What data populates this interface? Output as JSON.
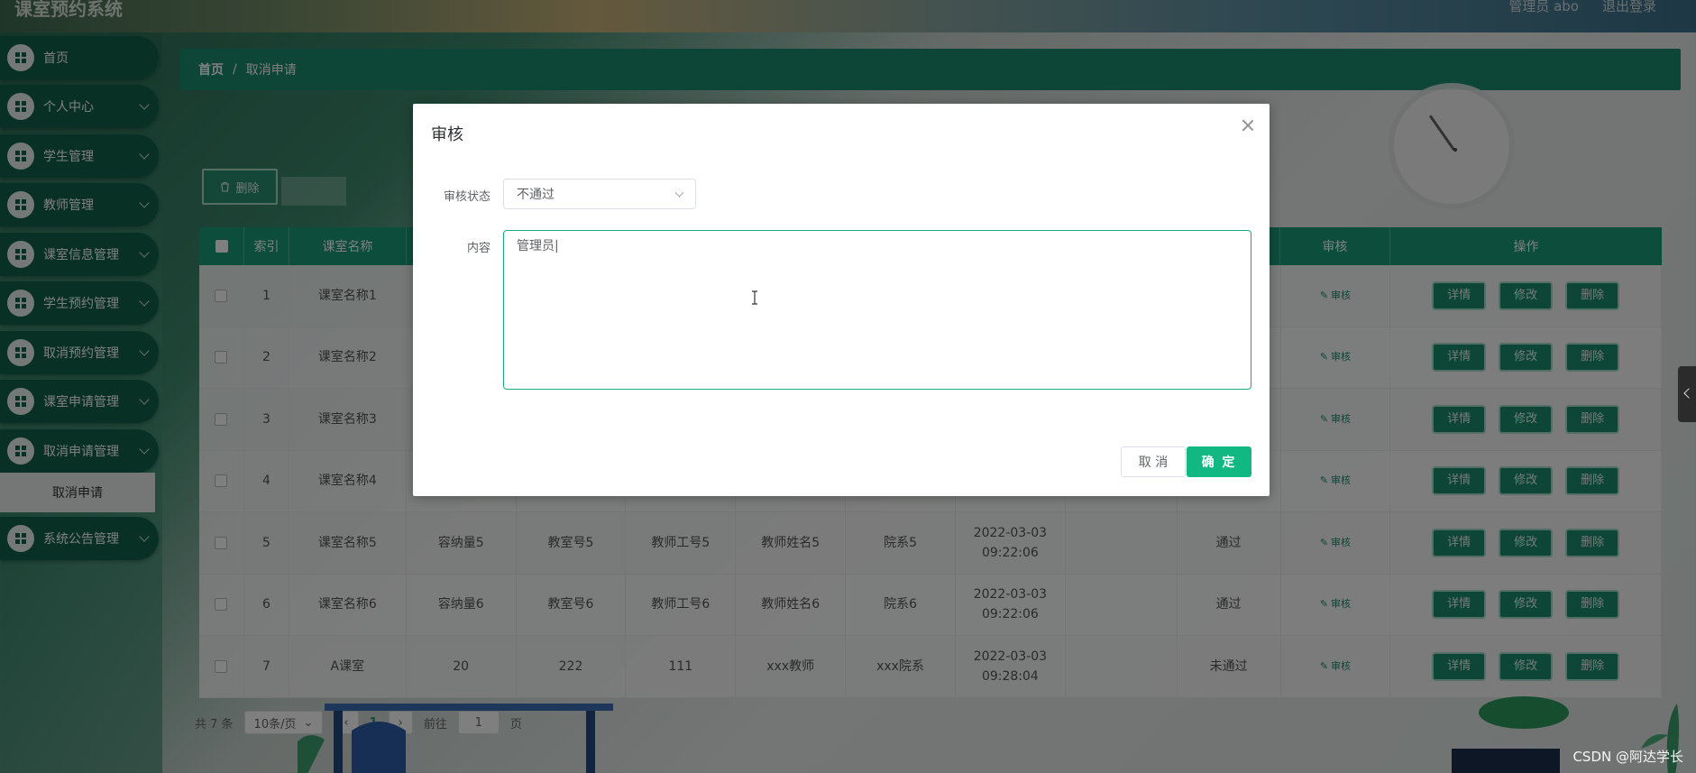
{
  "header": {
    "app_title": "课室预约系统",
    "admin_label": "管理员 abo",
    "logout_label": "退出登录"
  },
  "sidebar": {
    "items": [
      {
        "label": "首页"
      },
      {
        "label": "个人中心"
      },
      {
        "label": "学生管理"
      },
      {
        "label": "教师管理"
      },
      {
        "label": "课室信息管理"
      },
      {
        "label": "学生预约管理"
      },
      {
        "label": "取消预约管理"
      },
      {
        "label": "课室申请管理"
      },
      {
        "label": "取消申请管理"
      },
      {
        "label": "系统公告管理"
      }
    ],
    "submenu_label": "取消申请"
  },
  "breadcrumb": {
    "home": "首页",
    "separator": "/",
    "current": "取消申请"
  },
  "toolbar": {
    "delete_label": "删除"
  },
  "table": {
    "headers": [
      "索引",
      "课室名称",
      "审核",
      "操作"
    ],
    "audit_link": "审核",
    "actions": [
      "详情",
      "修改",
      "删除"
    ],
    "rows": [
      {
        "index": "1",
        "name": "课室名称1",
        "capacity": "",
        "room": "",
        "tid": "",
        "tname": "",
        "dept": "",
        "time": "",
        "status": ""
      },
      {
        "index": "2",
        "name": "课室名称2",
        "capacity": "",
        "room": "",
        "tid": "",
        "tname": "",
        "dept": "",
        "time": "",
        "status": ""
      },
      {
        "index": "3",
        "name": "课室名称3",
        "capacity": "",
        "room": "",
        "tid": "",
        "tname": "",
        "dept": "",
        "time": "",
        "status": ""
      },
      {
        "index": "4",
        "name": "课室名称4",
        "capacity": "",
        "room": "",
        "tid": "",
        "tname": "",
        "dept": "",
        "time": "22:06",
        "status": ""
      },
      {
        "index": "5",
        "name": "课室名称5",
        "capacity": "容纳量5",
        "room": "教室号5",
        "tid": "教师工号5",
        "tname": "教师姓名5",
        "dept": "院系5",
        "time": "2022-03-03 09:22:06",
        "status": "通过"
      },
      {
        "index": "6",
        "name": "课室名称6",
        "capacity": "容纳量6",
        "room": "教室号6",
        "tid": "教师工号6",
        "tname": "教师姓名6",
        "dept": "院系6",
        "time": "2022-03-03 09:22:06",
        "status": "通过"
      },
      {
        "index": "7",
        "name": "A课室",
        "capacity": "20",
        "room": "222",
        "tid": "111",
        "tname": "xxx教师",
        "dept": "xxx院系",
        "time": "2022-03-03 09:28:04",
        "status": "未通过"
      }
    ]
  },
  "pagination": {
    "total": "共 7 条",
    "page_size": "10条/页",
    "current_page": "1",
    "goto_label": "前往",
    "goto_value": "1",
    "page_suffix": "页"
  },
  "modal": {
    "title": "审核",
    "status_label": "审核状态",
    "status_value": "不通过",
    "content_label": "内容",
    "content_value": "管理员|",
    "cancel_label": "取 消",
    "ok_label": "确 定"
  },
  "watermark": "CSDN @阿达学长",
  "colors": {
    "primary": "#1b8c6c",
    "accent": "#12b882",
    "sidebar_item": "#13614a"
  }
}
